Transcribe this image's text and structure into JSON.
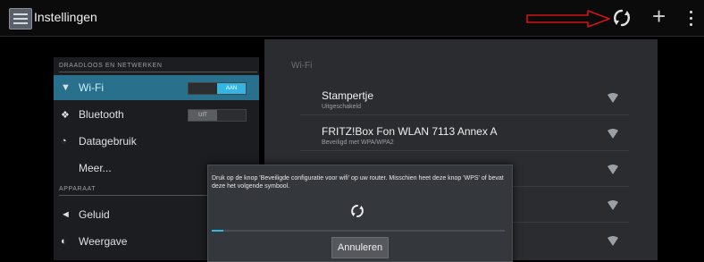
{
  "actionbar": {
    "title": "Instellingen",
    "plus_label": "+",
    "icons": [
      "settings-app-icon",
      "arrow-annotation-icon",
      "wps-icon",
      "add-icon",
      "overflow-menu-icon"
    ]
  },
  "left": {
    "section_wireless": "DRAADLOOS EN NETWERKEN",
    "section_device": "APPARAAT",
    "items": [
      {
        "label": "Wi-Fi",
        "icon": "wifi-icon",
        "toggle": "AAN"
      },
      {
        "label": "Bluetooth",
        "icon": "bluetooth-icon",
        "toggle": "UIT"
      },
      {
        "label": "Datagebruik",
        "icon": "data-usage-icon"
      },
      {
        "label": "Meer..."
      },
      {
        "label": "Geluid",
        "icon": "sound-icon"
      },
      {
        "label": "Weergave",
        "icon": "display-icon"
      }
    ]
  },
  "right": {
    "title": "Wi-Fi",
    "networks": [
      {
        "name": "Stampertje",
        "status": "Uitgeschakeld"
      },
      {
        "name": "FRITZ!Box Fon WLAN 7113 Annex A",
        "status": "Beveiligd met WPA/WPA2"
      }
    ]
  },
  "dialog": {
    "message": "Druk op de knop 'Beveiligde configuratie voor wifi' op uw router. Misschien heet deze knop 'WPS' of bevat deze het volgende symbool.",
    "progress": 0.01,
    "cancel_label": "Annuleren"
  },
  "colors": {
    "accent": "#33b5e5",
    "background": "#000000",
    "panel": "#2a2c2f"
  }
}
